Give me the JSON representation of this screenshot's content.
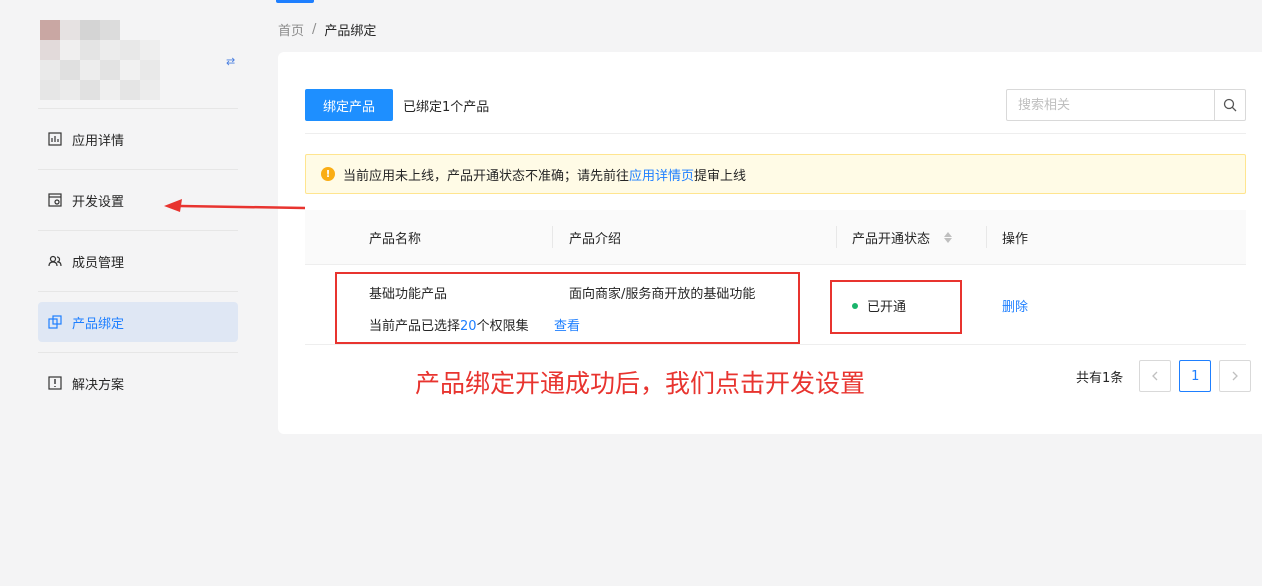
{
  "sidebar": {
    "items": [
      {
        "label": "应用详情",
        "icon": "chart-icon"
      },
      {
        "label": "开发设置",
        "icon": "settings-icon"
      },
      {
        "label": "成员管理",
        "icon": "members-icon"
      },
      {
        "label": "产品绑定",
        "icon": "link-icon",
        "active": true
      },
      {
        "label": "解决方案",
        "icon": "solution-icon"
      }
    ]
  },
  "breadcrumb": {
    "home": "首页",
    "separator": "/",
    "current": "产品绑定"
  },
  "toolbar": {
    "bind_button": "绑定产品",
    "bound_prefix": "已绑定",
    "bound_count": "1",
    "bound_suffix": "个产品",
    "search_placeholder": "搜索相关"
  },
  "alert": {
    "text_before": "当前应用未上线，产品开通状态不准确；请先前往",
    "link": "应用详情页",
    "text_after": "提审上线"
  },
  "table": {
    "columns": [
      "产品名称",
      "产品介绍",
      "产品开通状态",
      "操作"
    ],
    "rows": [
      {
        "name": "基础功能产品",
        "permission_prefix": "当前产品已选择",
        "permission_count": "20",
        "permission_suffix": "个权限集",
        "view_link": "查看",
        "intro": "面向商家/服务商开放的基础功能",
        "status": "已开通",
        "action": "删除"
      }
    ]
  },
  "pagination": {
    "total": "共有1条",
    "current_page": "1"
  },
  "annotation": {
    "text": "产品绑定开通成功后，我们点击开发设置"
  },
  "colors": {
    "primary": "#1e7fff",
    "annotation": "#e8342f",
    "success": "#19b46b",
    "warning": "#faad14"
  }
}
